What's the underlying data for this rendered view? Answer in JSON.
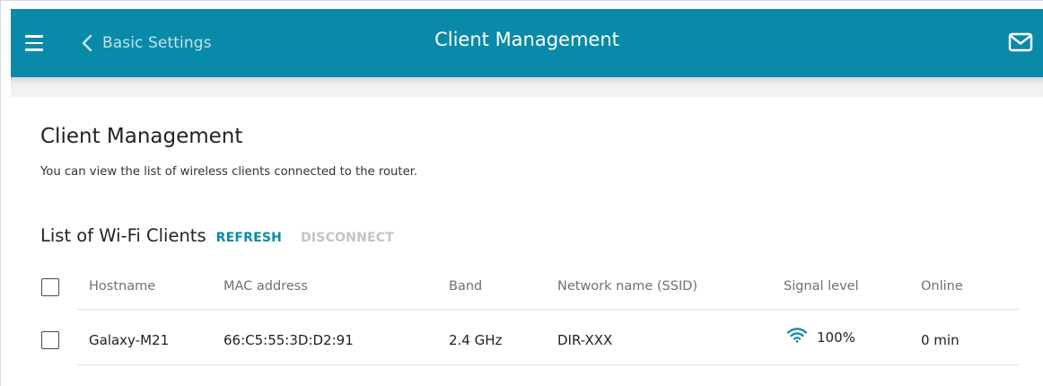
{
  "header": {
    "back_label": "Basic Settings",
    "title": "Client Management",
    "accent_color": "#0a8aa9"
  },
  "page": {
    "heading": "Client Management",
    "description": "You can view the list of wireless clients connected to the router."
  },
  "clients": {
    "title": "List of Wi-Fi Clients",
    "refresh_label": "REFRESH",
    "disconnect_label": "DISCONNECT",
    "columns": {
      "hostname": "Hostname",
      "mac": "MAC address",
      "band": "Band",
      "ssid": "Network name (SSID)",
      "signal": "Signal level",
      "online": "Online"
    },
    "rows": [
      {
        "hostname": "Galaxy-M21",
        "mac": "66:C5:55:3D:D2:91",
        "band": "2.4 GHz",
        "ssid": "DIR-XXX",
        "signal": "100%",
        "online": "0 min",
        "selected": false
      }
    ]
  }
}
